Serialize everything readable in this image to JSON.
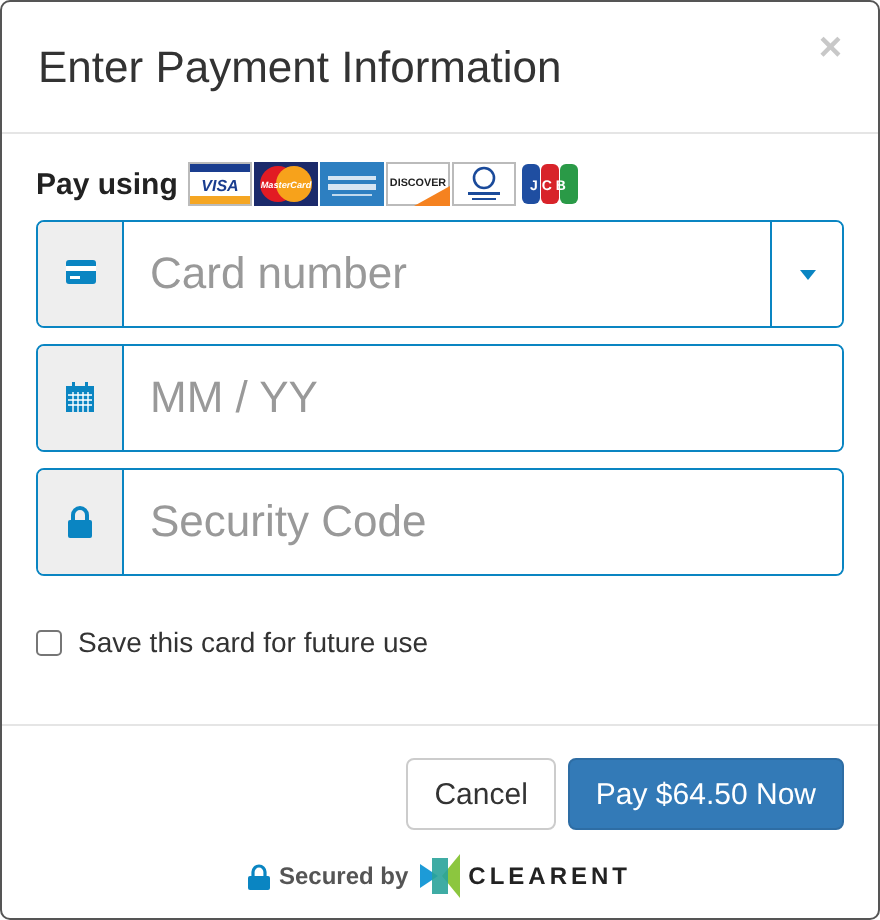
{
  "dialog": {
    "title": "Enter Payment Information",
    "close": "×"
  },
  "pay_using": {
    "label": "Pay using",
    "cards": [
      {
        "kind": "visa",
        "label": "VISA"
      },
      {
        "kind": "mastercard",
        "label": "MasterCard"
      },
      {
        "kind": "amex"
      },
      {
        "kind": "discover",
        "label": "DISCOVER"
      },
      {
        "kind": "diners"
      },
      {
        "kind": "jcb",
        "label": "JCB"
      }
    ]
  },
  "fields": [
    {
      "kind": "card",
      "placeholder": "Card number",
      "dropdown": true
    },
    {
      "kind": "calendar",
      "placeholder": "MM / YY",
      "dropdown": false
    },
    {
      "kind": "lock",
      "placeholder": "Security Code",
      "dropdown": false
    }
  ],
  "save_card": {
    "label": "Save this card for future use",
    "checked": false
  },
  "buttons": [
    {
      "label": "Cancel",
      "kind": "default"
    },
    {
      "label": "Pay $64.50 Now",
      "kind": "primary"
    }
  ],
  "footer": {
    "secured_by": "Secured by",
    "brand": "CLEARENT"
  }
}
